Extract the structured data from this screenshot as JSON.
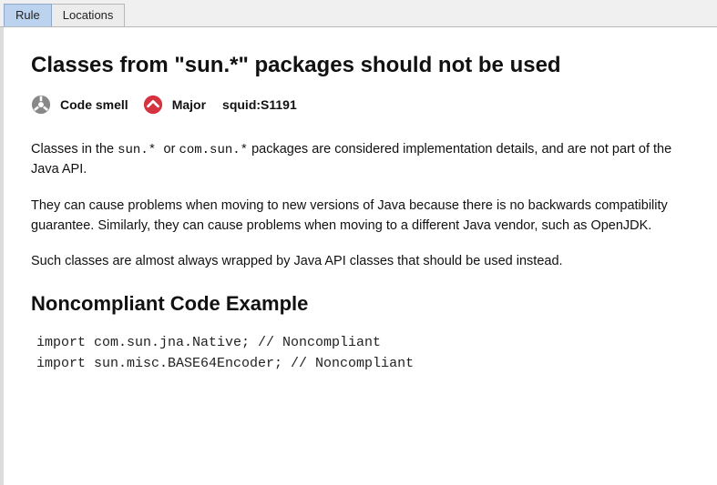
{
  "tabs": {
    "rule": "Rule",
    "locations": "Locations"
  },
  "rule": {
    "title": "Classes from \"sun.*\" packages should not be used",
    "type_label": "Code smell",
    "severity_label": "Major",
    "key": "squid:S1191"
  },
  "description": {
    "p1_pre": "Classes in the ",
    "p1_code": "sun.* ",
    "p1_mid": "or ",
    "p1_code2": "com.sun.*",
    "p1_post": " packages are considered implementation details, and are not part of the Java API.",
    "p2": "They can cause problems when moving to new versions of Java because there is no backwards compatibility guarantee. Similarly, they can cause problems when moving to a different Java vendor, such as OpenJDK.",
    "p3": "Such classes are almost always wrapped by Java API classes that should be used instead."
  },
  "noncompliant": {
    "heading": "Noncompliant Code Example",
    "code": "import com.sun.jna.Native; // Noncompliant\nimport sun.misc.BASE64Encoder; // Noncompliant"
  },
  "colors": {
    "severity_red": "#d4333f",
    "type_grey": "#888888"
  }
}
